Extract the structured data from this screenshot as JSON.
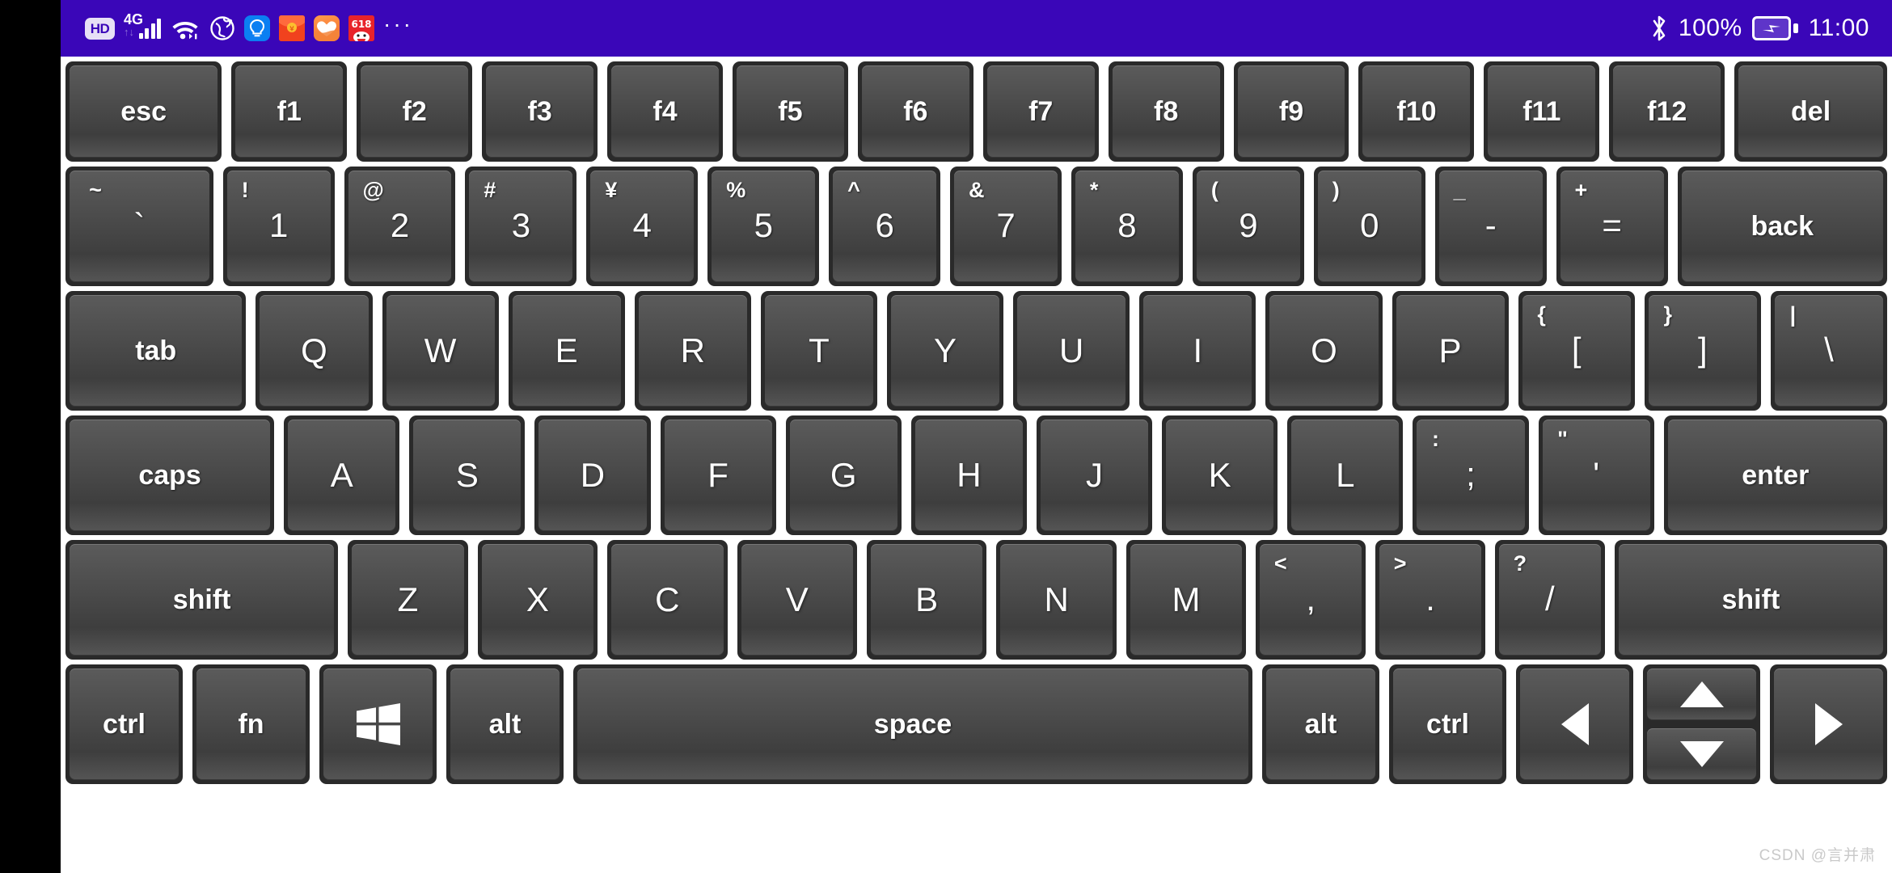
{
  "statusbar": {
    "background": "#3A06B8",
    "hd_label": "HD",
    "network_label": "4G",
    "network_updown": "↑↓",
    "icons": [
      "hd-badge",
      "signal-4g",
      "wifi-icon",
      "vpn-globe-icon",
      "lightbulb-app-icon",
      "red-envelope-app-icon",
      "health-app-icon",
      "jd-618-app-icon",
      "more-icons"
    ],
    "battery_percent": "100%",
    "bluetooth_glyph": "",
    "clock": "11:00",
    "battery_charging": true
  },
  "watermark": "CSDN @言并肃",
  "keyboard": {
    "rows": [
      {
        "name": "function-row",
        "keys": [
          {
            "n": "esc",
            "label": "esc",
            "type": "word",
            "w": 2.0
          },
          {
            "n": "f1",
            "label": "f1",
            "type": "word",
            "w": 1.45
          },
          {
            "n": "f2",
            "label": "f2",
            "type": "word",
            "w": 1.45
          },
          {
            "n": "f3",
            "label": "f3",
            "type": "word",
            "w": 1.45
          },
          {
            "n": "f4",
            "label": "f4",
            "type": "word",
            "w": 1.45
          },
          {
            "n": "f5",
            "label": "f5",
            "type": "word",
            "w": 1.45
          },
          {
            "n": "f6",
            "label": "f6",
            "type": "word",
            "w": 1.45
          },
          {
            "n": "f7",
            "label": "f7",
            "type": "word",
            "w": 1.45
          },
          {
            "n": "f8",
            "label": "f8",
            "type": "word",
            "w": 1.45
          },
          {
            "n": "f9",
            "label": "f9",
            "type": "word",
            "w": 1.45
          },
          {
            "n": "f10",
            "label": "f10",
            "type": "word",
            "w": 1.45
          },
          {
            "n": "f11",
            "label": "f11",
            "type": "word",
            "w": 1.45
          },
          {
            "n": "f12",
            "label": "f12",
            "type": "word",
            "w": 1.45
          },
          {
            "n": "del",
            "label": "del",
            "type": "word",
            "w": 1.95
          }
        ]
      },
      {
        "name": "number-row",
        "keys": [
          {
            "n": "backquote",
            "top": "~",
            "bottom": "`",
            "type": "dual",
            "w": 1.35
          },
          {
            "n": "1",
            "top": "!",
            "bottom": "1",
            "type": "dual",
            "w": 1.0
          },
          {
            "n": "2",
            "top": "@",
            "bottom": "2",
            "type": "dual",
            "w": 1.0
          },
          {
            "n": "3",
            "top": "#",
            "bottom": "3",
            "type": "dual",
            "w": 1.0
          },
          {
            "n": "4",
            "top": "¥",
            "bottom": "4",
            "type": "dual",
            "w": 1.0
          },
          {
            "n": "5",
            "top": "%",
            "bottom": "5",
            "type": "dual",
            "w": 1.0
          },
          {
            "n": "6",
            "top": "^",
            "bottom": "6",
            "type": "dual",
            "w": 1.0
          },
          {
            "n": "7",
            "top": "&",
            "bottom": "7",
            "type": "dual",
            "w": 1.0
          },
          {
            "n": "8",
            "top": "*",
            "bottom": "8",
            "type": "dual",
            "w": 1.0
          },
          {
            "n": "9",
            "top": "(",
            "bottom": "9",
            "type": "dual",
            "w": 1.0
          },
          {
            "n": "0",
            "top": ")",
            "bottom": "0",
            "type": "dual",
            "w": 1.0
          },
          {
            "n": "minus",
            "top": "_",
            "bottom": "-",
            "type": "dual",
            "w": 1.0
          },
          {
            "n": "equal",
            "top": "+",
            "bottom": "=",
            "type": "dual",
            "w": 1.0
          },
          {
            "n": "back",
            "label": "back",
            "type": "word",
            "w": 1.95
          }
        ]
      },
      {
        "name": "qwerty-row",
        "keys": [
          {
            "n": "tab",
            "label": "tab",
            "type": "word",
            "w": 1.75
          },
          {
            "n": "q",
            "label": "Q",
            "type": "letter",
            "w": 1.1
          },
          {
            "n": "w",
            "label": "W",
            "type": "letter",
            "w": 1.1
          },
          {
            "n": "e",
            "label": "E",
            "type": "letter",
            "w": 1.1
          },
          {
            "n": "r",
            "label": "R",
            "type": "letter",
            "w": 1.1
          },
          {
            "n": "t",
            "label": "T",
            "type": "letter",
            "w": 1.1
          },
          {
            "n": "y",
            "label": "Y",
            "type": "letter",
            "w": 1.1
          },
          {
            "n": "u",
            "label": "U",
            "type": "letter",
            "w": 1.1
          },
          {
            "n": "i",
            "label": "I",
            "type": "letter",
            "w": 1.1
          },
          {
            "n": "o",
            "label": "O",
            "type": "letter",
            "w": 1.1
          },
          {
            "n": "p",
            "label": "P",
            "type": "letter",
            "w": 1.1
          },
          {
            "n": "bracketleft",
            "top": "{",
            "bottom": "[",
            "type": "dual",
            "w": 1.1
          },
          {
            "n": "bracketright",
            "top": "}",
            "bottom": "]",
            "type": "dual",
            "w": 1.1
          },
          {
            "n": "backslash",
            "top": "|",
            "bottom": "\\",
            "type": "dual",
            "w": 1.1
          }
        ]
      },
      {
        "name": "home-row",
        "keys": [
          {
            "n": "caps",
            "label": "caps",
            "type": "word",
            "w": 2.05
          },
          {
            "n": "a",
            "label": "A",
            "type": "letter",
            "w": 1.1
          },
          {
            "n": "s",
            "label": "S",
            "type": "letter",
            "w": 1.1
          },
          {
            "n": "d",
            "label": "D",
            "type": "letter",
            "w": 1.1
          },
          {
            "n": "f",
            "label": "F",
            "type": "letter",
            "w": 1.1
          },
          {
            "n": "g",
            "label": "G",
            "type": "letter",
            "w": 1.1
          },
          {
            "n": "h",
            "label": "H",
            "type": "letter",
            "w": 1.1
          },
          {
            "n": "j",
            "label": "J",
            "type": "letter",
            "w": 1.1
          },
          {
            "n": "k",
            "label": "K",
            "type": "letter",
            "w": 1.1
          },
          {
            "n": "l",
            "label": "L",
            "type": "letter",
            "w": 1.1
          },
          {
            "n": "semicolon",
            "top": ":",
            "bottom": ";",
            "type": "dual",
            "w": 1.1
          },
          {
            "n": "quote",
            "top": "\"",
            "bottom": "'",
            "type": "dual",
            "w": 1.1
          },
          {
            "n": "enter",
            "label": "enter",
            "type": "word",
            "w": 2.2
          }
        ]
      },
      {
        "name": "shift-row",
        "keys": [
          {
            "n": "shift-left",
            "label": "shift",
            "type": "word",
            "w": 2.6
          },
          {
            "n": "z",
            "label": "Z",
            "type": "letter",
            "w": 1.1
          },
          {
            "n": "x",
            "label": "X",
            "type": "letter",
            "w": 1.1
          },
          {
            "n": "c",
            "label": "C",
            "type": "letter",
            "w": 1.1
          },
          {
            "n": "v",
            "label": "V",
            "type": "letter",
            "w": 1.1
          },
          {
            "n": "b",
            "label": "B",
            "type": "letter",
            "w": 1.1
          },
          {
            "n": "n",
            "label": "N",
            "type": "letter",
            "w": 1.1
          },
          {
            "n": "m",
            "label": "M",
            "type": "letter",
            "w": 1.1
          },
          {
            "n": "comma",
            "top": "<",
            "bottom": ",",
            "type": "dual",
            "w": 1.0
          },
          {
            "n": "period",
            "top": ">",
            "bottom": ".",
            "type": "dual",
            "w": 1.0
          },
          {
            "n": "slash",
            "top": "?",
            "bottom": "/",
            "type": "dual",
            "w": 1.0
          },
          {
            "n": "shift-right",
            "label": "shift",
            "type": "word",
            "w": 2.6
          }
        ]
      },
      {
        "name": "bottom-row",
        "keys": [
          {
            "n": "ctrl-left",
            "label": "ctrl",
            "type": "word",
            "w": 1.35
          },
          {
            "n": "fn",
            "label": "fn",
            "type": "word",
            "w": 1.35
          },
          {
            "n": "win",
            "label": "",
            "type": "winlogo",
            "w": 1.35
          },
          {
            "n": "alt-left",
            "label": "alt",
            "type": "word",
            "w": 1.35
          },
          {
            "n": "space",
            "label": "space",
            "type": "word",
            "w": 8.3
          },
          {
            "n": "alt-right",
            "label": "alt",
            "type": "word",
            "w": 1.35
          },
          {
            "n": "ctrl-right",
            "label": "ctrl",
            "type": "word",
            "w": 1.35
          },
          {
            "n": "arrow-left",
            "label": "◀",
            "type": "arrow-left",
            "w": 1.35
          },
          {
            "n": "arrow-updown",
            "label": "",
            "type": "updown",
            "w": 1.35
          },
          {
            "n": "arrow-right",
            "label": "▶",
            "type": "arrow-right",
            "w": 1.35
          }
        ]
      }
    ]
  }
}
